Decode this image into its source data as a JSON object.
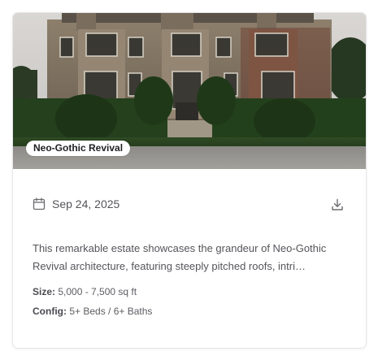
{
  "listing": {
    "style_badge": "Neo-Gothic Revival",
    "date": "Sep 24, 2025",
    "description": "This remarkable estate showcases the grandeur of Neo-Gothic Revival architecture, featuring steeply pitched roofs, intri…",
    "size_label": "Size:",
    "size_value": "5,000 - 7,500 sq ft",
    "config_label": "Config:",
    "config_value": "5+ Beds / 6+ Baths"
  },
  "icons": {
    "date": "calendar-icon",
    "action": "download-icon"
  },
  "colors": {
    "card_border": "#e6e6e9",
    "text_primary": "#1f1f24",
    "text_muted": "#55555b",
    "badge_bg": "#ffffff"
  }
}
